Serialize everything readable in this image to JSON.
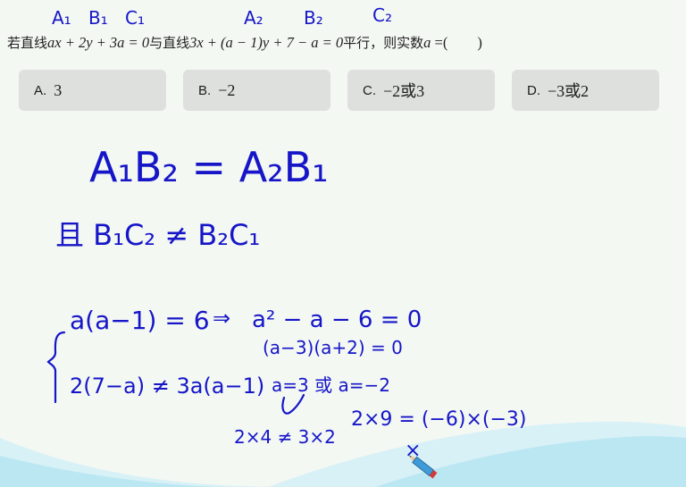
{
  "question": {
    "prefix_cn": "若直线",
    "line1": "ax + 2y + 3a = 0",
    "mid_cn": "与直线",
    "line2": "3x + (a − 1)y + 7 − a = 0",
    "suffix_cn": "平行，则实数",
    "var": "a",
    "blank": " =(　　)"
  },
  "options": [
    {
      "letter": "A.",
      "value": "3"
    },
    {
      "letter": "B.",
      "value": "−2"
    },
    {
      "letter": "C.",
      "value": "−2或3"
    },
    {
      "letter": "D.",
      "value": "−3或2"
    }
  ],
  "annotations": {
    "coef_labels": [
      "A₁",
      "B₁",
      "C₁",
      "A₂",
      "B₂",
      "C₂"
    ],
    "condition_1": "A₁B₂ = A₂B₁",
    "condition_2": "且 B₁C₂ ≠ B₂C₁",
    "eq_1": "a(a−1) = 6",
    "implies": "⇒",
    "quadratic": "a² − a − 6 = 0",
    "factored": "(a−3)(a+2) = 0",
    "roots": "a=3 或 a=−2",
    "eq_2": "2(7−a) ≠ 3a(a−1)",
    "check_1": "2×4 ≠ 3×2",
    "check_2": "2×9 = (−6)×(−3)",
    "reject_mark": "×"
  },
  "colors": {
    "ink": "#1616c8",
    "background": "#f4f8f3",
    "option_bg": "#dde0dc",
    "wave_light": "#d6f0f6",
    "wave_dark": "#b8e6f3"
  }
}
